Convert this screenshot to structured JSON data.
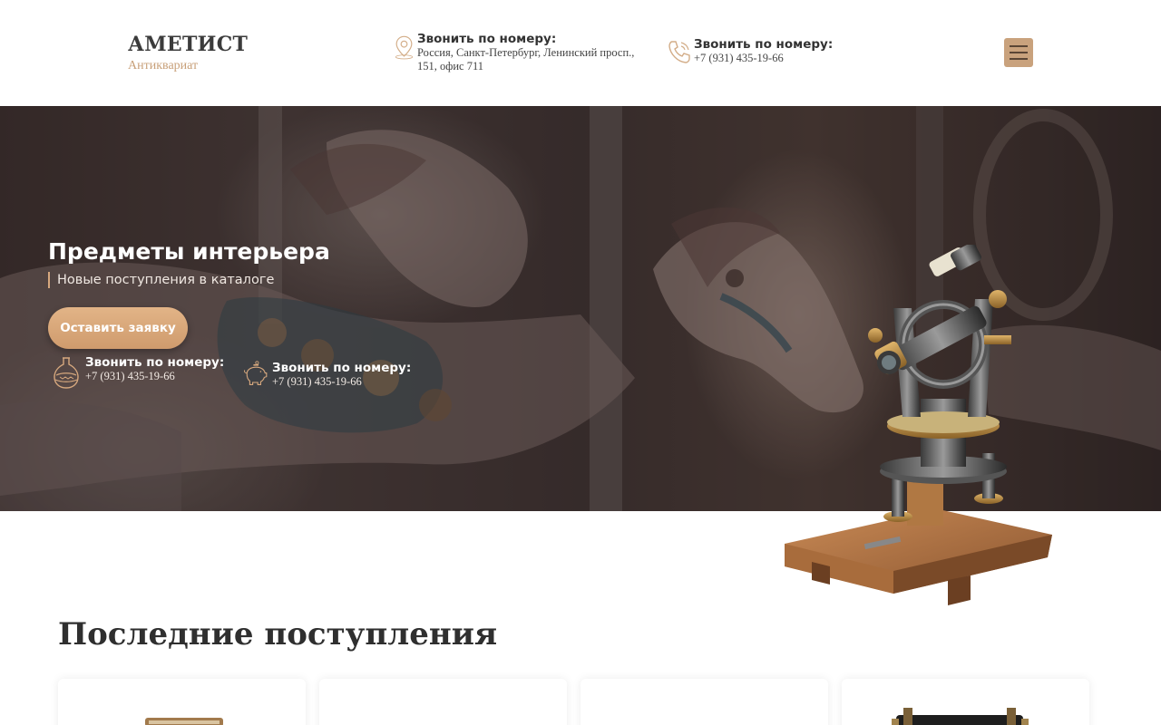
{
  "header": {
    "brand_name": "АМЕТИСТ",
    "brand_sub": "Антиквариат",
    "address": {
      "title": "Звонить по номеру:",
      "text": "Россия, Санкт-Петербург, Ленинский просп., 151, офис 711",
      "icon": "map-pin-icon"
    },
    "phone": {
      "title": "Звонить по номеру:",
      "text": "+7 (931) 435-19-66",
      "icon": "phone-icon"
    },
    "menu_icon": "hamburger-menu-icon"
  },
  "hero": {
    "title": "Предметы интерьера",
    "subtitle": "Новые поступления в каталоге",
    "cta_label": "Оставить заявку",
    "contacts": [
      {
        "title": "Звонить по номеру:",
        "text": "+7 (931) 435-19-66",
        "icon": "vase-icon"
      },
      {
        "title": "Звонить по номеру:",
        "text": "+7 (931) 435-19-66",
        "icon": "piggy-bank-icon"
      }
    ]
  },
  "latest": {
    "title": "Последние поступления"
  },
  "colors": {
    "accent": "#d6a87e",
    "burger": "#c9a27d",
    "title_dark": "#2f2f2f"
  }
}
